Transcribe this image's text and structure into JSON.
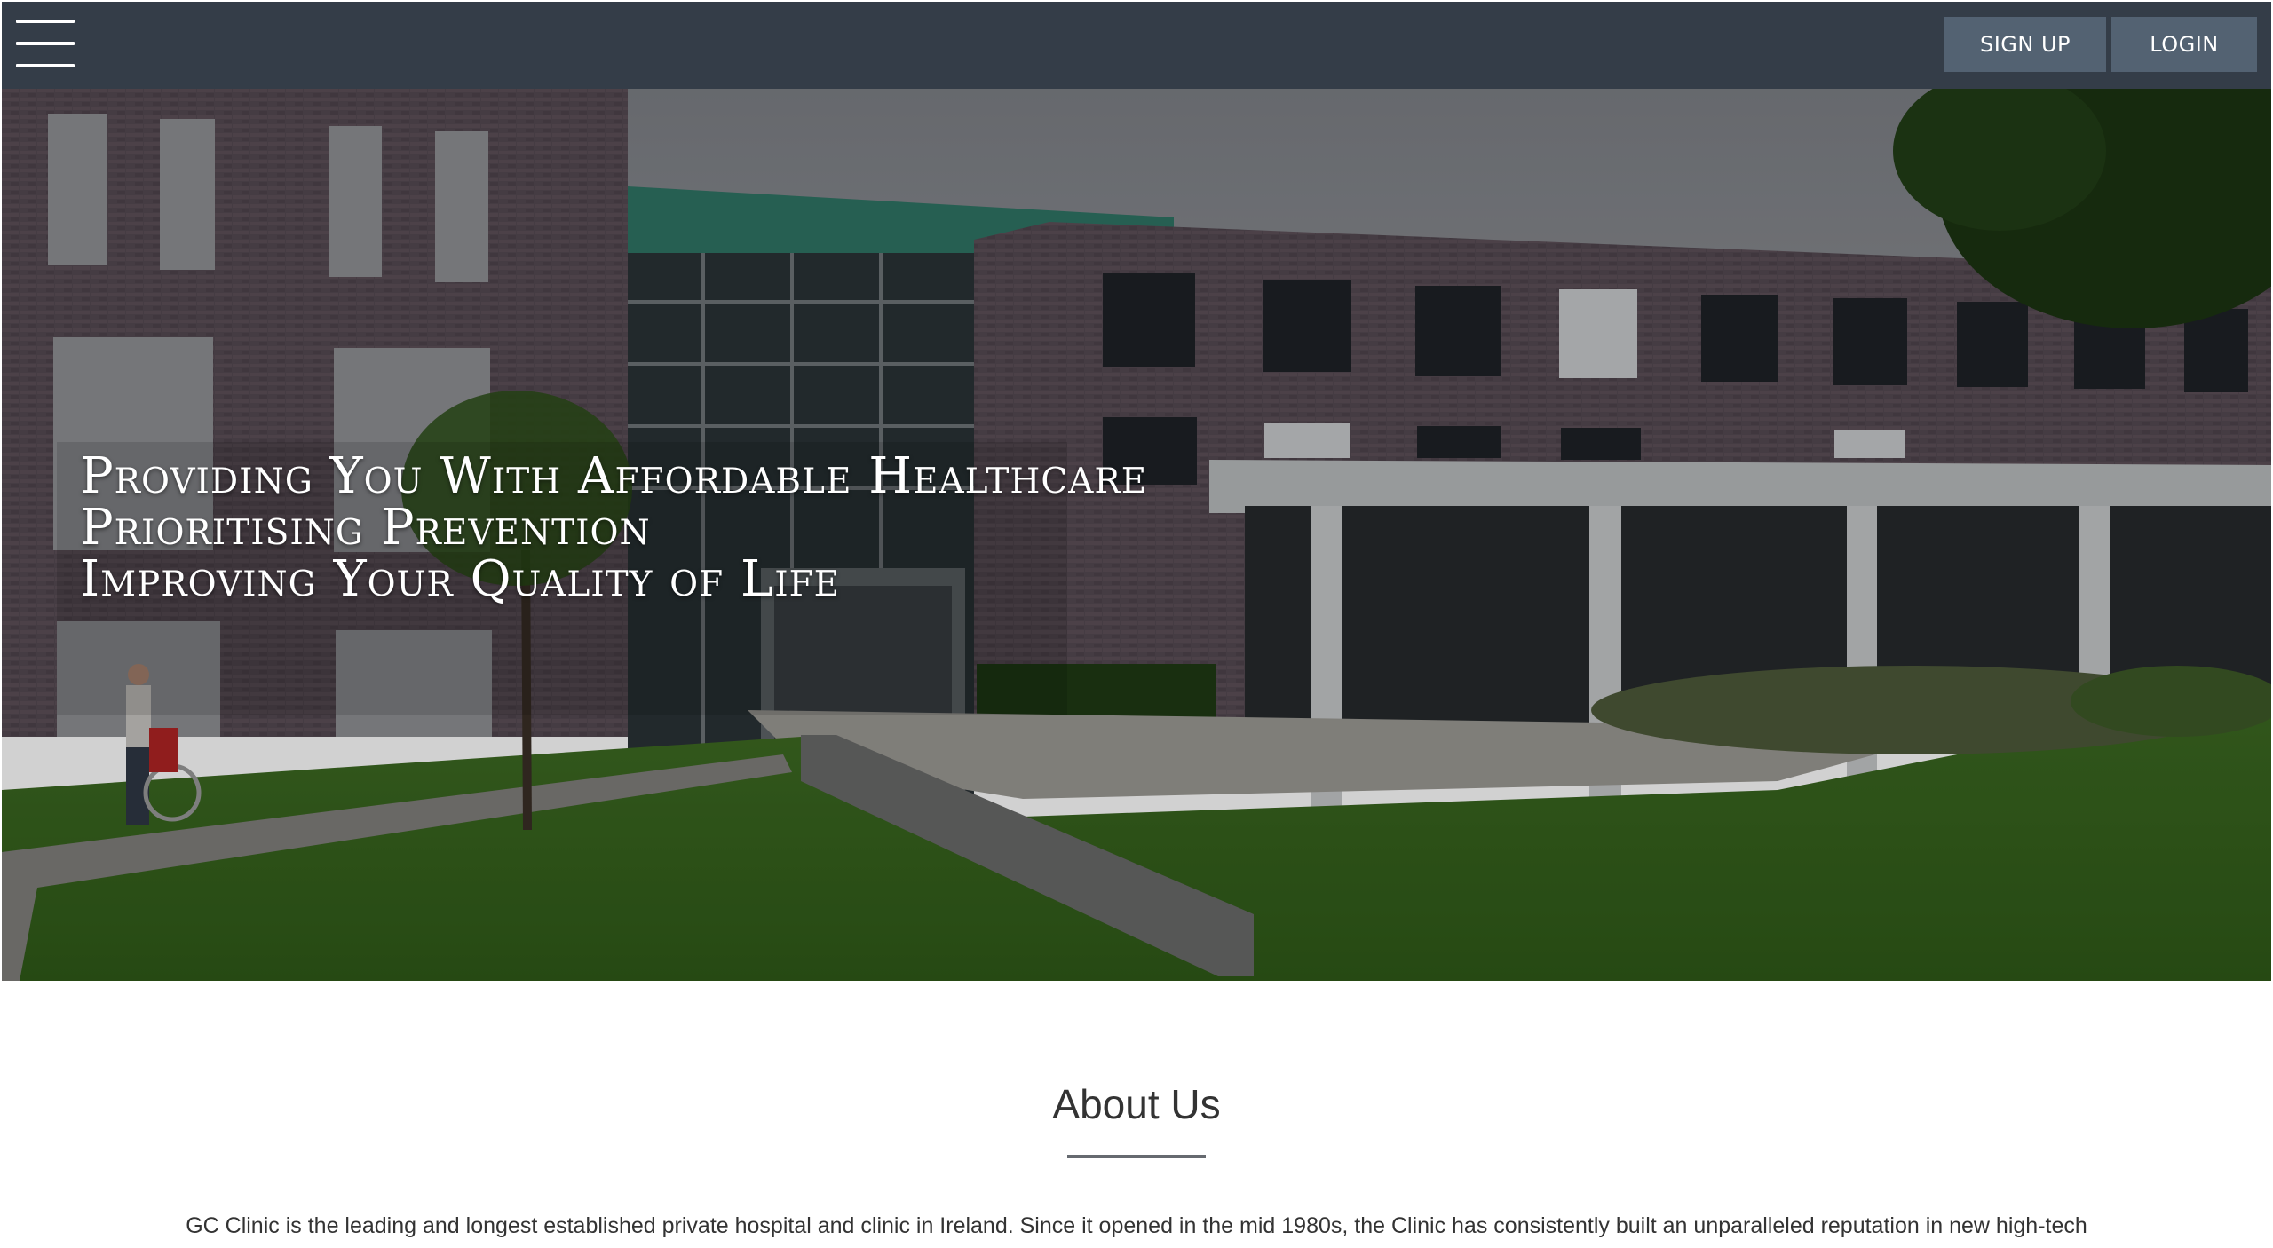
{
  "nav": {
    "menu_icon": "hamburger-menu-icon",
    "signup_label": "SIGN UP",
    "login_label": "LOGIN",
    "bar_color": "#343d48",
    "button_color": "#536272"
  },
  "hero": {
    "lines": [
      "Providing You With Affordable Healthcare",
      "Prioritising Prevention",
      "Improving Your Quality of Life"
    ]
  },
  "about": {
    "title": "About Us",
    "text": "GC Clinic is the leading and longest established private hospital and clinic in Ireland. Since it opened in the mid 1980s, the Clinic has consistently built an unparalleled reputation in new high-tech"
  }
}
